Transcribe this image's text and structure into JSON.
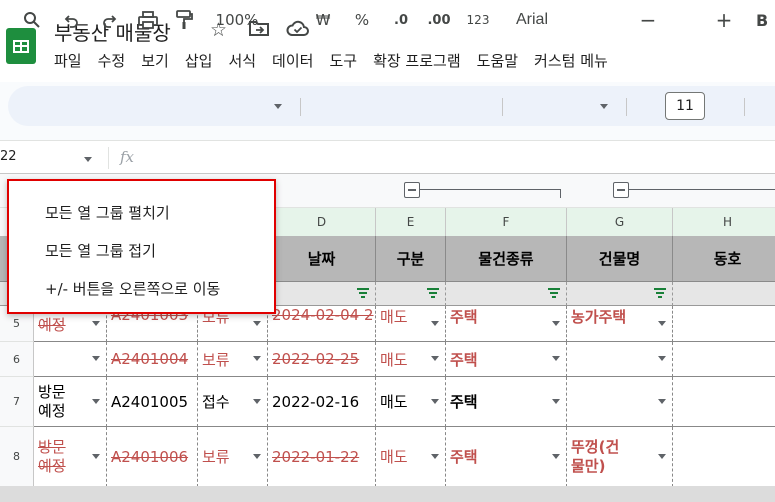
{
  "app": {
    "doc_title": "부동산 매물장",
    "menu": [
      "파일",
      "수정",
      "보기",
      "삽입",
      "서식",
      "데이터",
      "도구",
      "확장 프로그램",
      "도움말",
      "커스텀 메뉴"
    ]
  },
  "toolbar": {
    "zoom": "100%",
    "currency": "₩",
    "percent": "%",
    "dec_decrease": ".0",
    "dec_increase": ".00",
    "number_format": "123",
    "font": "Arial",
    "font_size": "11",
    "minus": "−",
    "plus": "+",
    "bold": "B"
  },
  "formula_bar": {
    "cell_ref": "22",
    "fx": "fx"
  },
  "context_menu": {
    "items": [
      "모든 열 그룹 펼치기",
      "모든 열 그룹 접기",
      "+/- 버튼을 오른쪽으로 이동"
    ]
  },
  "columns": [
    "D",
    "E",
    "F",
    "G",
    "H"
  ],
  "header_labels": {
    "date": "날짜",
    "type": "구분",
    "kind": "물건종류",
    "building": "건물명",
    "unit": "동호"
  },
  "rows": [
    {
      "num": "5",
      "status": "예정",
      "code": "A2401003",
      "state": "보류",
      "date": "2024-02-04 2",
      "deal": "매도",
      "kind": "주택",
      "building": "농가주택"
    },
    {
      "num": "6",
      "status": "",
      "code": "A2401004",
      "state": "보류",
      "date": "2022-02-25",
      "deal": "매도",
      "kind": "주택",
      "building": ""
    },
    {
      "num": "7",
      "status": "방문\n예정",
      "code": "A2401005",
      "state": "접수",
      "date": "2022-02-16",
      "deal": "매도",
      "kind": "주택",
      "building": ""
    },
    {
      "num": "8",
      "status": "방문\n예정",
      "code": "A2401006",
      "state": "보류",
      "date": "2022-01-22",
      "deal": "매도",
      "kind": "주택",
      "building": "뚜껑(건\n물만)"
    }
  ]
}
